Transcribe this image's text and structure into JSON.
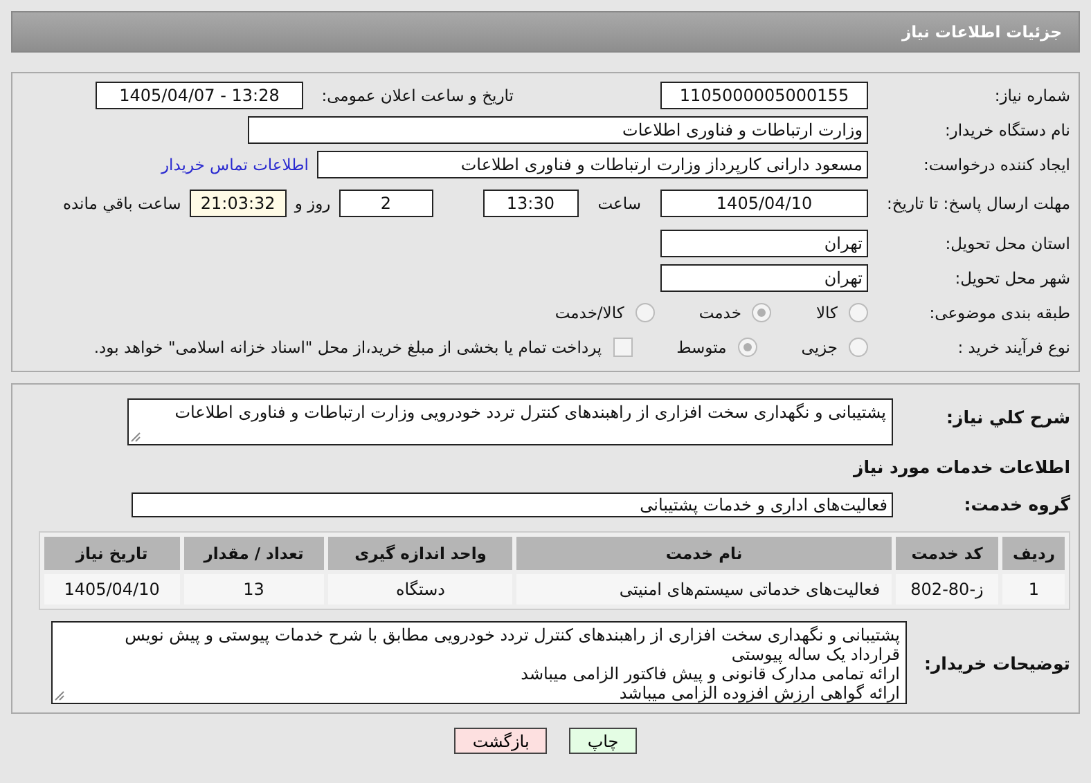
{
  "header": {
    "title": "جزئیات اطلاعات نیاز"
  },
  "need_number": {
    "label": "شماره نیاز:",
    "value": "1105000005000155"
  },
  "announce": {
    "label": "تاریخ و ساعت اعلان عمومی:",
    "value": "1405/04/07 - 13:28"
  },
  "buyer": {
    "label": "نام دستگاه خریدار:",
    "value": "وزارت ارتباطات و فناوری اطلاعات"
  },
  "creator": {
    "label": "ایجاد کننده درخواست:",
    "value": "مسعود دارانی کارپرداز وزارت ارتباطات و فناوری اطلاعات",
    "link": "اطلاعات تماس خریدار"
  },
  "deadline": {
    "label": "مهلت ارسال پاسخ: تا تاریخ:",
    "date": "1405/04/10",
    "time_label": "ساعت",
    "time": "13:30",
    "days": "2",
    "days_label": "روز و",
    "remaining": "21:03:32",
    "remaining_label": "ساعت باقي مانده"
  },
  "province": {
    "label": "استان محل تحویل:",
    "value": "تهران"
  },
  "city": {
    "label": "شهر محل تحویل:",
    "value": "تهران"
  },
  "category": {
    "label": "طبقه بندی موضوعی:",
    "options": [
      {
        "label": "کالا",
        "selected": false
      },
      {
        "label": "خدمت",
        "selected": true
      },
      {
        "label": "کالا/خدمت",
        "selected": false
      }
    ]
  },
  "process": {
    "label": "نوع فرآیند خرید :",
    "options": [
      {
        "label": "جزیی",
        "selected": false
      },
      {
        "label": "متوسط",
        "selected": true
      }
    ],
    "treasury": {
      "checked": false,
      "text": "پرداخت تمام یا بخشی از مبلغ خرید،از محل \"اسناد خزانه اسلامی\" خواهد بود."
    }
  },
  "description": {
    "label": "شرح کلي نیاز:",
    "value": "پشتیبانی و نگهداری سخت افزاری از راهبندهای کنترل تردد خودرویی وزارت ارتباطات و فناوری اطلاعات"
  },
  "services_heading": "اطلاعات خدمات مورد نیاز",
  "service_group": {
    "label": "گروه خدمت:",
    "value": "فعالیت‌های اداری و خدمات پشتیبانی"
  },
  "table": {
    "columns": [
      "ردیف",
      "کد خدمت",
      "نام خدمت",
      "واحد اندازه گیری",
      "تعداد / مقدار",
      "تاریخ نیاز"
    ],
    "rows": [
      [
        "1",
        "ز-80-802",
        "فعالیت‌های خدماتی سیستم‌های امنیتی",
        "دستگاه",
        "13",
        "1405/04/10"
      ]
    ]
  },
  "notes": {
    "label": "توضیحات خریدار:",
    "lines": [
      "پشتیبانی و نگهداری سخت افزاری از راهبندهای کنترل تردد خودرویی مطابق با شرح خدمات پیوستی و پیش نویس قرارداد یک ساله پیوستی",
      "ارائه تمامی مدارک قانونی و پیش فاکتور الزامی میباشد",
      "ارائه گواهی ارزش افزوده الزامی میباشد"
    ]
  },
  "buttons": [
    {
      "label": "چاپ",
      "kind": "print"
    },
    {
      "label": "بازگشت",
      "kind": "back"
    }
  ]
}
